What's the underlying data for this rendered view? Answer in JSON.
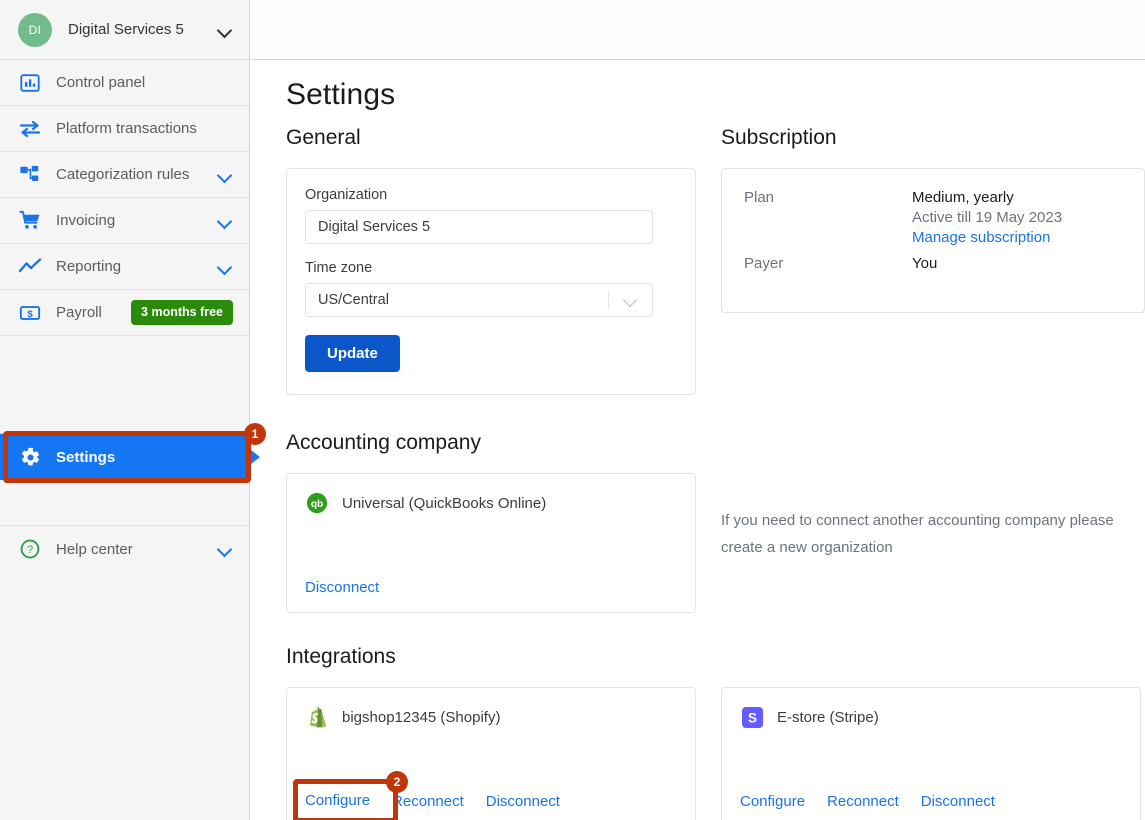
{
  "sidebar": {
    "org": {
      "initials": "DI",
      "name": "Digital Services 5",
      "chevron_icon": "chevron-down-icon"
    },
    "items": [
      {
        "label": "Control panel",
        "icon": "dashboard-icon",
        "has_chevron": false
      },
      {
        "label": "Platform transactions",
        "icon": "transfer-arrows-icon",
        "has_chevron": false
      },
      {
        "label": "Categorization rules",
        "icon": "sitemap-icon",
        "has_chevron": true
      },
      {
        "label": "Invoicing",
        "icon": "shopping-cart-icon",
        "has_chevron": true
      },
      {
        "label": "Reporting",
        "icon": "line-chart-icon",
        "has_chevron": true
      },
      {
        "label": "Payroll",
        "icon": "money-bill-icon",
        "has_chevron": false,
        "badge": "3 months free"
      },
      {
        "label": "Settings",
        "icon": "gear-icon",
        "has_chevron": false,
        "active": true
      }
    ],
    "help": {
      "label": "Help center",
      "icon": "question-circle-icon"
    }
  },
  "annotations": [
    {
      "number": "1",
      "target": "sidebar-item-settings"
    },
    {
      "number": "2",
      "target": "shopify-configure-link"
    }
  ],
  "main": {
    "page_title": "Settings",
    "general": {
      "heading": "General",
      "organization_label": "Organization",
      "organization_value": "Digital Services 5",
      "organization_placeholder": "Organization",
      "timezone_label": "Time zone",
      "timezone_value": "US/Central",
      "update_label": "Update"
    },
    "subscription": {
      "heading": "Subscription",
      "plan_label": "Plan",
      "plan_value": "Medium, yearly",
      "plan_active_till": "Active till 19 May 2023",
      "manage_link": "Manage subscription",
      "payer_label": "Payer",
      "payer_value": "You"
    },
    "accounting": {
      "heading": "Accounting company",
      "provider_name": "Universal (QuickBooks Online)",
      "provider_icon": "quickbooks-icon",
      "disconnect_label": "Disconnect",
      "note": "If you need to connect another accounting company please create a new organization"
    },
    "integrations": {
      "heading": "Integrations",
      "cards": [
        {
          "name": "bigshop12345 (Shopify)",
          "icon": "shopify-icon",
          "actions": [
            "Configure",
            "Reconnect",
            "Disconnect"
          ]
        },
        {
          "name": "E-store (Stripe)",
          "icon": "stripe-icon",
          "actions": [
            "Configure",
            "Reconnect",
            "Disconnect"
          ]
        }
      ]
    }
  },
  "colors": {
    "accent_blue": "#1a73e8",
    "active_blue": "#1476f2",
    "button_blue": "#0b57c9",
    "badge_green": "#2a8a0a",
    "annotation_red": "#bf3708",
    "avatar_green": "#72bb8d"
  }
}
